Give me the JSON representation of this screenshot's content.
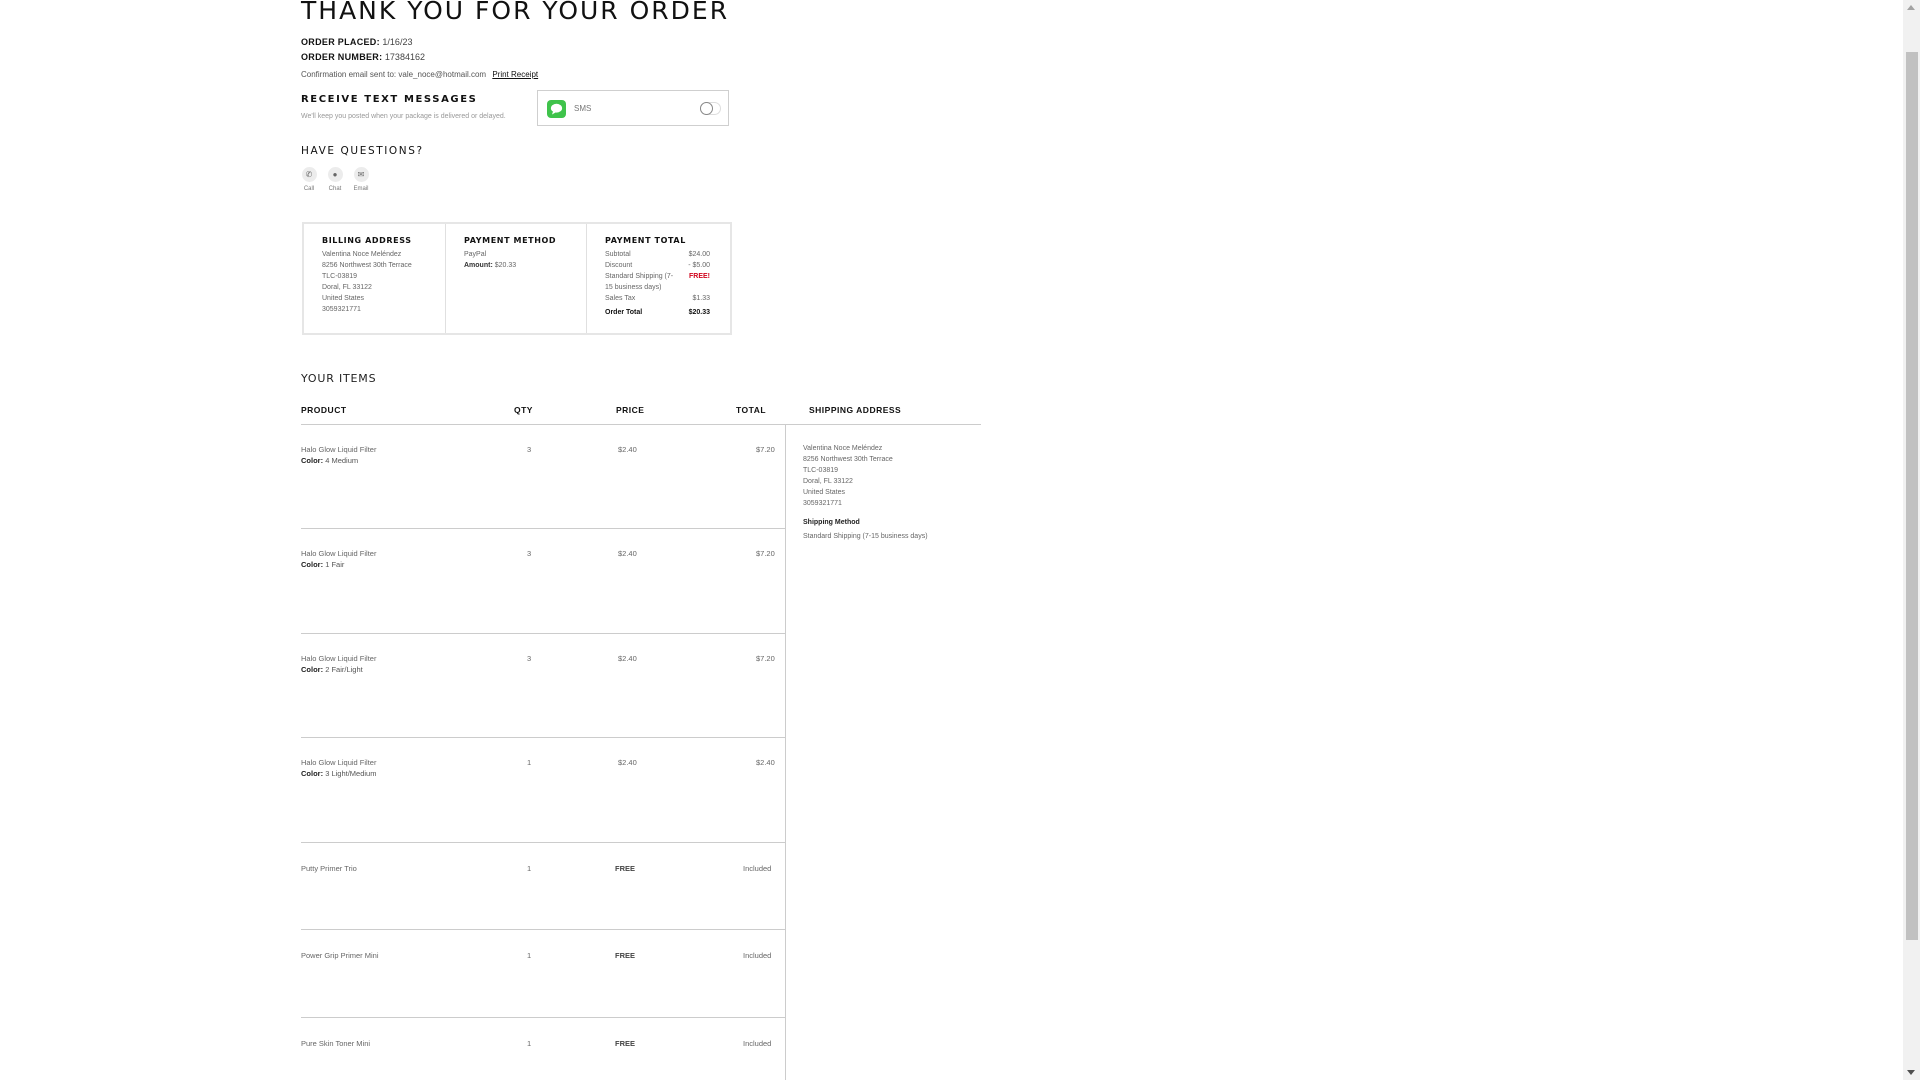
{
  "header": {
    "title": "THANK YOU FOR YOUR ORDER",
    "order_placed_label": "ORDER PLACED:",
    "order_placed_value": "1/16/23",
    "order_number_label": "ORDER NUMBER:",
    "order_number_value": "17384162",
    "confirmation_text": "Confirmation email sent to: vale_noce@hotmail.com",
    "print_receipt": "Print Receipt"
  },
  "text_messages": {
    "heading": "RECEIVE TEXT MESSAGES",
    "note": "We'll keep you posted when your package is delivered or delayed.",
    "sms_label": "SMS",
    "sms_enabled": false
  },
  "questions": {
    "heading": "HAVE QUESTIONS?",
    "contacts": [
      {
        "label": "Call",
        "icon": "phone-icon"
      },
      {
        "label": "Chat",
        "icon": "chat-icon"
      },
      {
        "label": "Email",
        "icon": "email-icon"
      }
    ]
  },
  "billing": {
    "heading": "BILLING ADDRESS",
    "lines": [
      "Valentina Noce Meléndez",
      "8256 Northwest 30th Terrace",
      "TLC-03819",
      "Doral, FL 33122",
      "United States",
      "3059321771"
    ]
  },
  "payment_method": {
    "heading": "PAYMENT METHOD",
    "method": "PayPal",
    "amount_label": "Amount:",
    "amount_value": "$20.33"
  },
  "payment_total": {
    "heading": "PAYMENT TOTAL",
    "subtotal_label": "Subtotal",
    "subtotal_value": "$24.00",
    "discount_label": "Discount",
    "discount_value": "- $5.00",
    "shipping_label_1": "Standard Shipping (7-",
    "shipping_label_2": "15 business days)",
    "shipping_value": "FREE!",
    "tax_label": "Sales Tax",
    "tax_value": "$1.33",
    "total_label": "Order Total",
    "total_value": "$20.33"
  },
  "items": {
    "heading": "YOUR ITEMS",
    "columns": {
      "product": "PRODUCT",
      "qty": "QTY",
      "price": "PRICE",
      "total": "TOTAL",
      "shipping": "SHIPPING ADDRESS"
    },
    "color_label": "Color:",
    "rows": [
      {
        "product": "Halo Glow Liquid Filter",
        "color": "4 Medium",
        "qty": "3",
        "price": "$2.40",
        "total": "$7.20"
      },
      {
        "product": "Halo Glow Liquid Filter",
        "color": "1 Fair",
        "qty": "3",
        "price": "$2.40",
        "total": "$7.20"
      },
      {
        "product": "Halo Glow Liquid Filter",
        "color": "2 Fair/Light",
        "qty": "3",
        "price": "$2.40",
        "total": "$7.20"
      },
      {
        "product": "Halo Glow Liquid Filter",
        "color": "3 Light/Medium",
        "qty": "1",
        "price": "$2.40",
        "total": "$2.40"
      },
      {
        "product": "Putty Primer Trio",
        "color": "",
        "qty": "1",
        "price": "FREE",
        "total": "Included"
      },
      {
        "product": "Power Grip Primer Mini",
        "color": "",
        "qty": "1",
        "price": "FREE",
        "total": "Included"
      },
      {
        "product": "Pure Skin Toner Mini",
        "color": "",
        "qty": "1",
        "price": "FREE",
        "total": "Included"
      }
    ]
  },
  "shipping": {
    "lines": [
      "Valentina Noce Meléndez",
      "8256 Northwest 30th Terrace",
      "TLC-03819",
      "Doral, FL 33122",
      "United States",
      "3059321771"
    ],
    "method_heading": "Shipping Method",
    "method_value": "Standard Shipping (7-15 business days)"
  },
  "colors": {
    "sms_green": "#3fc34b",
    "free_red": "#d0021b",
    "border": "#e6e6e6"
  }
}
